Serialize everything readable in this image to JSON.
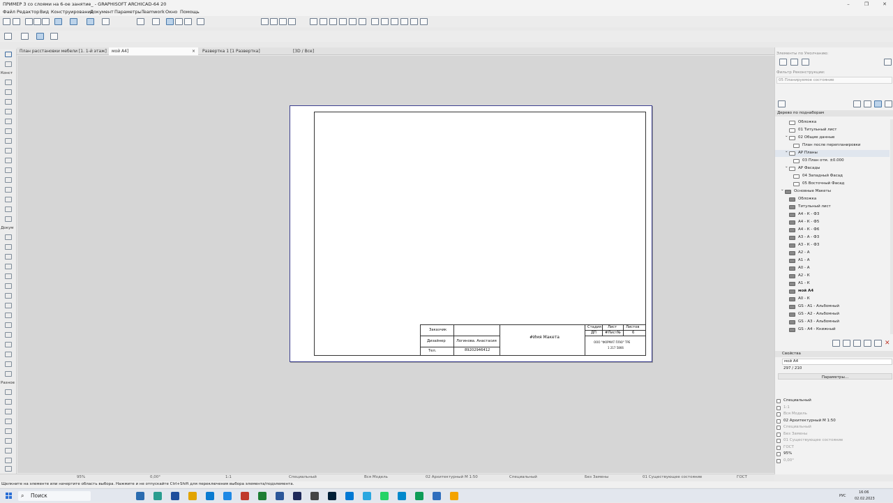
{
  "window": {
    "title": "ПРИМЕР 3 со слоями на 6-ое занятие_ - GRAPHISOFT ARCHICAD-64 20",
    "min": "–",
    "max": "❐",
    "close": "✕"
  },
  "menu": [
    "Файл",
    "Редактор",
    "Вид",
    "Конструирование",
    "Документ",
    "Параметры",
    "Teamwork",
    "Окно",
    "Помощь"
  ],
  "tabs": [
    {
      "label": "План расстановки мебели [1. 1-й этаж]"
    },
    {
      "label": "мой А4]"
    },
    {
      "label": "Развертка 1 [1 Развертка]"
    },
    {
      "label": "[3D / Все]"
    }
  ],
  "tab_close": "×",
  "left_sections": [
    "Конст",
    "Докум",
    "Разное"
  ],
  "stamp": {
    "customer_label": "Заказчик",
    "designer_label": "Дизайнер",
    "designer_name": "Логинова. Анастасия",
    "tel_label": "Тел.",
    "tel_value": "89202946412",
    "layout_name": "#Имя Макета",
    "stage_label": "Стадия",
    "sheet_label": "Лист",
    "sheets_label": "Листов",
    "stage_value": "ДП",
    "sheet_value": "#Лист№",
    "sheets_value": "6",
    "company": "ООО  \"ФОРМАТ ПЛЮ\"  ТРЕ",
    "company_sub": "1 217 5866"
  },
  "right_panel": {
    "defaults_label": "Элементы по Умолчанию:",
    "renovation_label": "Фильтр Реконструкции:",
    "renovation_value": "05 Планируемое состояние",
    "tree_title": "Дерево по поднаборам",
    "tree": [
      {
        "label": "Обложка",
        "indent": 1,
        "dark": false
      },
      {
        "label": "01 Титульный лист",
        "indent": 1,
        "dark": false
      },
      {
        "label": "02 Общие данные",
        "indent": 1,
        "dark": false,
        "arrow": "⌄"
      },
      {
        "label": "План после перепланировки",
        "indent": 2,
        "dark": false
      },
      {
        "label": "АР Планы",
        "indent": 1,
        "dark": false,
        "arrow": "⌄",
        "sel": true
      },
      {
        "label": "03 План отм. ±0.000",
        "indent": 2,
        "dark": false
      },
      {
        "label": "АР Фасады",
        "indent": 1,
        "dark": false,
        "arrow": "⌄"
      },
      {
        "label": "04 Западный Фасад",
        "indent": 2,
        "dark": false
      },
      {
        "label": "05 Восточный Фасад",
        "indent": 2,
        "dark": false
      },
      {
        "label": "Основные Макеты",
        "indent": 0,
        "dark": true,
        "arrow": "⌄"
      },
      {
        "label": "Обложка",
        "indent": 1,
        "dark": true
      },
      {
        "label": "Титульный лист",
        "indent": 1,
        "dark": true
      },
      {
        "label": "А4 - К - Ф3",
        "indent": 1,
        "dark": true
      },
      {
        "label": "А4 - К - Ф5",
        "indent": 1,
        "dark": true
      },
      {
        "label": "А4 - К - Ф6",
        "indent": 1,
        "dark": true
      },
      {
        "label": "А3 - А - Ф3",
        "indent": 1,
        "dark": true
      },
      {
        "label": "А3 - К - Ф3",
        "indent": 1,
        "dark": true
      },
      {
        "label": "А2 - А",
        "indent": 1,
        "dark": true
      },
      {
        "label": "А1 - А",
        "indent": 1,
        "dark": true
      },
      {
        "label": "А0 - А",
        "indent": 1,
        "dark": true
      },
      {
        "label": "А2 - К",
        "indent": 1,
        "dark": true
      },
      {
        "label": "А1 - К",
        "indent": 1,
        "dark": true
      },
      {
        "label": "мой А4",
        "indent": 1,
        "dark": true,
        "bold": true
      },
      {
        "label": "А0 - К",
        "indent": 1,
        "dark": true
      },
      {
        "label": "GS - А1 - Альбомный",
        "indent": 1,
        "dark": true
      },
      {
        "label": "GS - А2 - Альбомный",
        "indent": 1,
        "dark": true
      },
      {
        "label": "GS - А3 - Альбомный",
        "indent": 1,
        "dark": true
      },
      {
        "label": "GS - А4 - Книжный",
        "indent": 1,
        "dark": true
      }
    ],
    "properties_title": "Свойства",
    "prop_name": "мой А4",
    "prop_size": "297 / 210",
    "params_button": "Параметры...",
    "settings": [
      {
        "label": "Специальный",
        "active": true
      },
      {
        "label": "1:1",
        "active": false
      },
      {
        "label": "Вся Модель",
        "active": false
      },
      {
        "label": "02 Архитектурный М 1:50",
        "active": true
      },
      {
        "label": "Специальный",
        "active": false
      },
      {
        "label": "Без Замены",
        "active": false
      },
      {
        "label": "01 Существующее состояние",
        "active": false
      },
      {
        "label": "ГОСТ",
        "active": false
      },
      {
        "label": "95%",
        "active": true
      },
      {
        "label": "0,00°",
        "active": false
      }
    ]
  },
  "status_bar": {
    "zoom": "95%",
    "angle": "0,00°",
    "scale": "1:1",
    "special": "Специальный",
    "model": "Вся Модель",
    "arch": "02 Архитектурный М 1:50",
    "special2": "Специальный",
    "noreplace": "Без Замены",
    "state": "01 Существующее состояние",
    "gost": "ГОСТ"
  },
  "hint": "Щелкните на элементе или начертите область выбора. Нажмите и не отпускайте Ctrl+Shift для переключения выбора элемента/подэлемента.",
  "taskbar": {
    "search": "Поиск",
    "lang": "РУС",
    "time": "16:06",
    "date": "02.02.2023",
    "apps": [
      "#2b6cb0",
      "#2a9d8f",
      "#1f4e9c",
      "#e2a400",
      "#0a7bd1",
      "#1e88e5",
      "#c0392b",
      "#1e7e34",
      "#2b579a",
      "#1f2a5a",
      "#444444",
      "#001e36",
      "#0078d4",
      "#2aa7e0",
      "#25d366",
      "#0088cc",
      "#0f9d58",
      "#2f6ebd",
      "#f4a300"
    ],
    "app_names": [
      "explorer-icon",
      "edge-icon",
      "archicad-icon",
      "files-icon",
      "chrome-icon",
      "edge2-icon",
      "pdf-icon",
      "excel-icon",
      "word-icon",
      "photoshop-icon",
      "media-icon",
      "ps2-icon",
      "skype-icon",
      "telegram-icon",
      "whatsapp-icon",
      "tg-icon",
      "sheets-icon",
      "doc-icon",
      "notes-icon"
    ]
  }
}
